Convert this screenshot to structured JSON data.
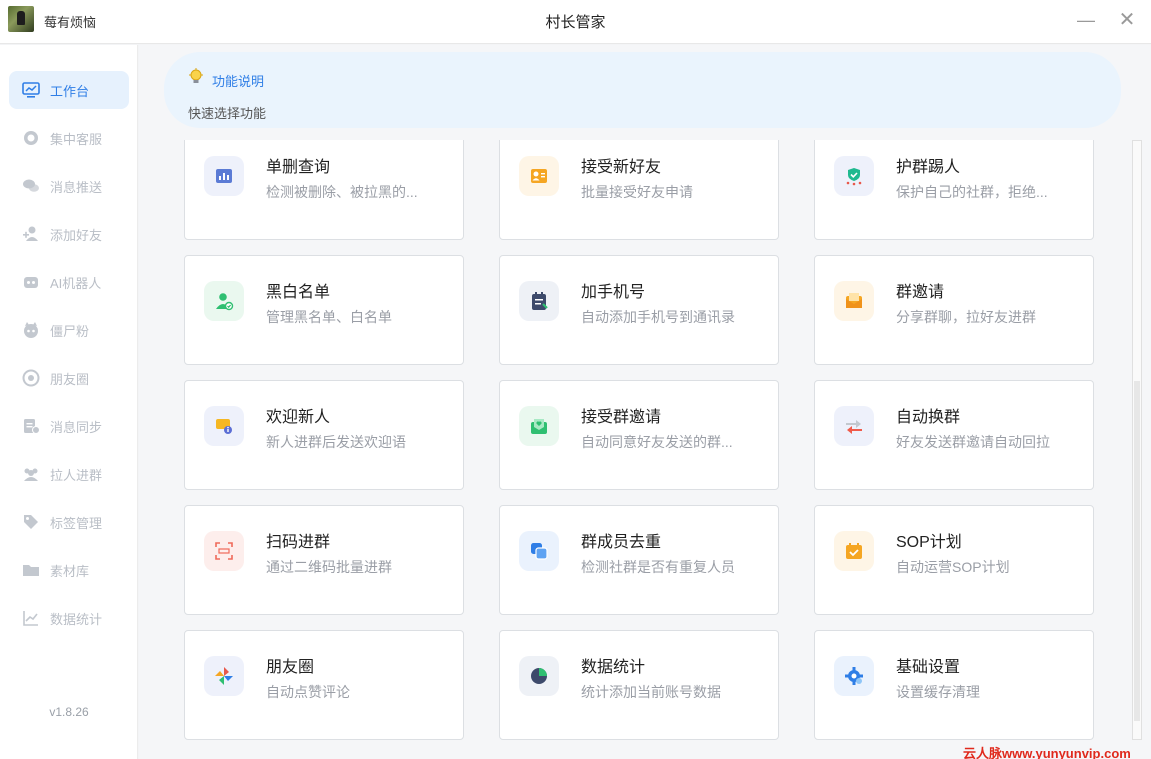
{
  "window": {
    "user_name": "莓有烦恼",
    "title": "村长管家",
    "minimize_glyph": "—",
    "close_glyph": "✕"
  },
  "sidebar": {
    "items": [
      {
        "label": "工作台",
        "icon": "monitor-chart-icon",
        "active": true
      },
      {
        "label": "集中客服",
        "icon": "headset-icon",
        "active": false
      },
      {
        "label": "消息推送",
        "icon": "chat-bubbles-icon",
        "active": false
      },
      {
        "label": "添加好友",
        "icon": "add-user-icon",
        "active": false
      },
      {
        "label": "AI机器人",
        "icon": "robot-icon",
        "active": false
      },
      {
        "label": "僵尸粉",
        "icon": "zombie-icon",
        "active": false
      },
      {
        "label": "朋友圈",
        "icon": "aperture-icon",
        "active": false
      },
      {
        "label": "消息同步",
        "icon": "sync-doc-icon",
        "active": false
      },
      {
        "label": "拉人进群",
        "icon": "group-icon",
        "active": false
      },
      {
        "label": "标签管理",
        "icon": "tag-icon",
        "active": false
      },
      {
        "label": "素材库",
        "icon": "folder-icon",
        "active": false
      },
      {
        "label": "数据统计",
        "icon": "line-chart-icon",
        "active": false
      }
    ],
    "version": "v1.8.26"
  },
  "notice": {
    "title": "功能说明",
    "description": "快速选择功能",
    "icon": "lightbulb-icon"
  },
  "features": [
    {
      "title": "单删查询",
      "desc": "检测被删除、被拉黑的...",
      "icon": "report-icon",
      "color": "#5b7bd5",
      "bg": "#eef1fb"
    },
    {
      "title": "接受新好友",
      "desc": "批量接受好友申请",
      "icon": "contact-card-icon",
      "color": "#f5a623",
      "bg": "#fef5e6"
    },
    {
      "title": "护群踢人",
      "desc": "保护自己的社群，拒绝...",
      "icon": "shield-group-icon",
      "color": "#1fb98f",
      "bg": "#eef1fb"
    },
    {
      "title": "黑白名单",
      "desc": "管理黑名单、白名单",
      "icon": "user-check-icon",
      "color": "#2fbf71",
      "bg": "#eaf8ef"
    },
    {
      "title": "加手机号",
      "desc": "自动添加手机号到通讯录",
      "icon": "notepad-icon",
      "color": "#3d4a6b",
      "bg": "#eef1f6"
    },
    {
      "title": "群邀请",
      "desc": "分享群聊，拉好友进群",
      "icon": "envelope-icon",
      "color": "#f5a623",
      "bg": "#fef5e6"
    },
    {
      "title": "欢迎新人",
      "desc": "新人进群后发送欢迎语",
      "icon": "welcome-chat-icon",
      "color": "#f5b723",
      "bg": "#eef1fb"
    },
    {
      "title": "接受群邀请",
      "desc": "自动同意好友发送的群...",
      "icon": "heart-mail-icon",
      "color": "#2fbf71",
      "bg": "#eaf8ef"
    },
    {
      "title": "自动换群",
      "desc": "好友发送群邀请自动回拉",
      "icon": "swap-arrows-icon",
      "color": "#f05a4a",
      "bg": "#eef1fb"
    },
    {
      "title": "扫码进群",
      "desc": "通过二维码批量进群",
      "icon": "scan-code-icon",
      "color": "#f06a5a",
      "bg": "#fdeeec"
    },
    {
      "title": "群成员去重",
      "desc": "检测社群是否有重复人员",
      "icon": "duplicate-icon",
      "color": "#2f7ee6",
      "bg": "#eaf2fd"
    },
    {
      "title": "SOP计划",
      "desc": "自动运营SOP计划",
      "icon": "calendar-check-icon",
      "color": "#f5a623",
      "bg": "#fef5e6"
    },
    {
      "title": "朋友圈",
      "desc": "自动点赞评论",
      "icon": "pinwheel-icon",
      "color": "#e8584a",
      "bg": "#eef1fb"
    },
    {
      "title": "数据统计",
      "desc": "统计添加当前账号数据",
      "icon": "pie-chart-icon",
      "color": "#3d4a6b",
      "bg": "#eef1f6"
    },
    {
      "title": "基础设置",
      "desc": "设置缓存清理",
      "icon": "gear-icon",
      "color": "#2f7ee6",
      "bg": "#eaf2fd"
    }
  ],
  "watermark": "云人脉www.yunyunvip.com"
}
